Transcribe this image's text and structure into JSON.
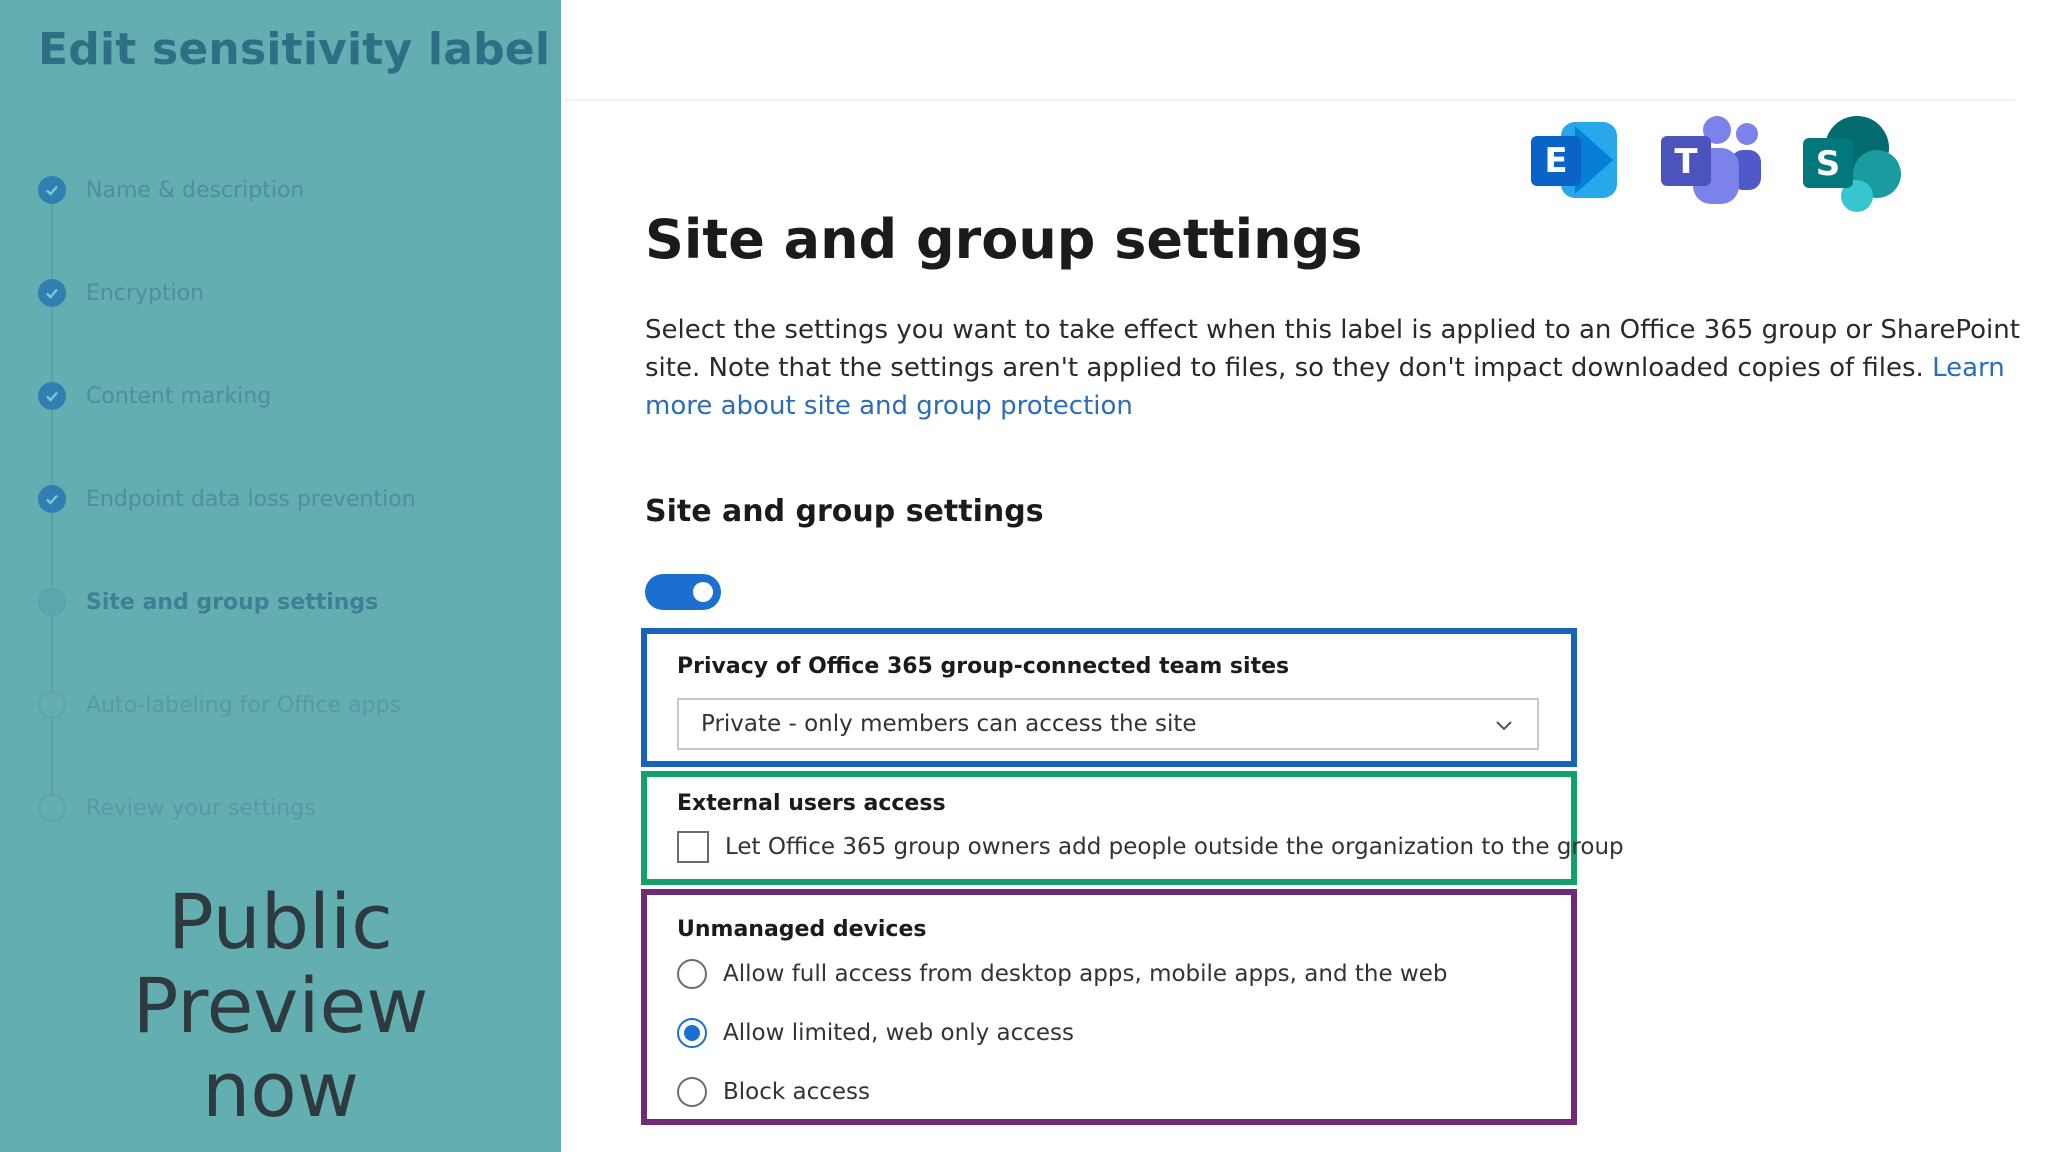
{
  "sidebar": {
    "title": "Edit sensitivity label",
    "steps": [
      {
        "label": "Name & description",
        "state": "done"
      },
      {
        "label": "Encryption",
        "state": "done"
      },
      {
        "label": "Content marking",
        "state": "done"
      },
      {
        "label": "Endpoint data loss prevention",
        "state": "done"
      },
      {
        "label": "Site and group settings",
        "state": "current"
      },
      {
        "label": "Auto-labeling for Office apps",
        "state": "todo"
      },
      {
        "label": "Review your settings",
        "state": "todo"
      }
    ],
    "promo": [
      "Public",
      "Preview",
      "now"
    ]
  },
  "apps": [
    {
      "icon": "exchange-icon",
      "letter": "E",
      "color": "#0a64c8"
    },
    {
      "icon": "teams-icon",
      "letter": "T",
      "color": "#5b5fc7"
    },
    {
      "icon": "sharepoint-icon",
      "letter": "S",
      "color": "#03787c"
    }
  ],
  "main": {
    "title": "Site and group settings",
    "description_1": "Select the settings you want to take effect when this label is applied to an Office 365 group or SharePoint site. Note that the settings aren't applied to files, so they don't impact downloaded copies of files. ",
    "description_link": "Learn more about site and group protection",
    "section_title": "Site and group settings",
    "toggle_on": true,
    "privacy": {
      "label": "Privacy of Office 365 group-connected team sites",
      "selected": "Private - only members can access the site"
    },
    "external": {
      "label": "External users access",
      "checkbox_label": "Let Office 365 group owners add people outside the organization to the group",
      "checked": false
    },
    "unmanaged": {
      "label": "Unmanaged devices",
      "options": [
        {
          "label": "Allow full access from desktop apps, mobile apps, and the web",
          "selected": false
        },
        {
          "label": "Allow limited, web only access",
          "selected": true
        },
        {
          "label": "Block access",
          "selected": false
        }
      ]
    }
  },
  "colors": {
    "sidebar_bg": "#63aeb1",
    "accent_blue": "#1a6fd1",
    "box_blue": "#1764b8",
    "box_green": "#13a06b",
    "box_purple": "#6f2a78",
    "link": "#2c6db8"
  }
}
